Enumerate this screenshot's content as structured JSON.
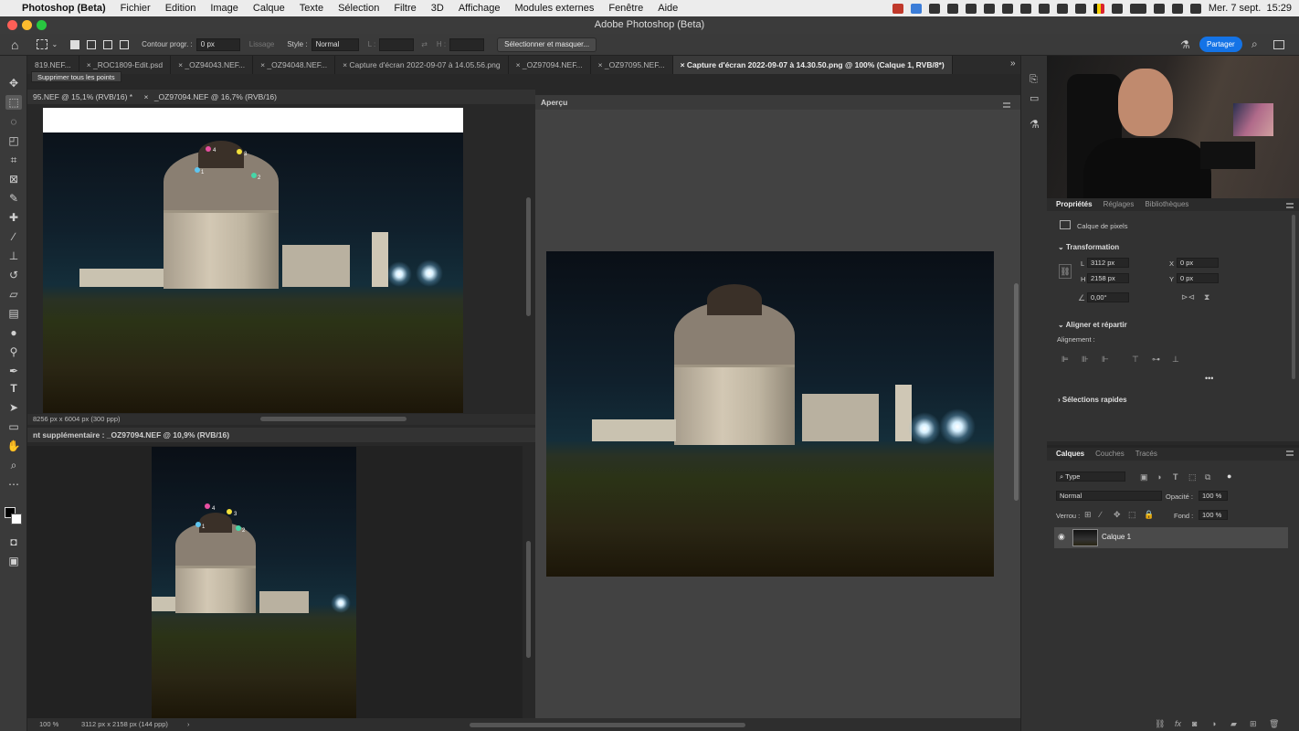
{
  "menubar": {
    "app": "Photoshop (Beta)",
    "items": [
      "Fichier",
      "Edition",
      "Image",
      "Calque",
      "Texte",
      "Sélection",
      "Filtre",
      "3D",
      "Affichage",
      "Modules externes",
      "Fenêtre",
      "Aide"
    ],
    "clock": "Mer. 7 sept.  15:29"
  },
  "window": {
    "title": "Adobe Photoshop (Beta)"
  },
  "options": {
    "contour_label": "Contour progr. :",
    "contour_value": "0 px",
    "lissage": "Lissage",
    "style_label": "Style :",
    "style_value": "Normal",
    "l_label": "L :",
    "h_label": "H :",
    "select_mask": "Sélectionner et masquer...",
    "share": "Partager"
  },
  "tabs": [
    {
      "label": "819.NEF..."
    },
    {
      "label": "_ROC1809-Edit.psd"
    },
    {
      "label": "_OZ94043.NEF..."
    },
    {
      "label": "_OZ94048.NEF..."
    },
    {
      "label": "Capture d'écran 2022-09-07 à 14.05.56.png"
    },
    {
      "label": "_OZ97094.NEF..."
    },
    {
      "label": "_OZ97095.NEF..."
    },
    {
      "label": "Capture d'écran 2022-09-07 à 14.30.50.png @ 100% (Calque 1, RVB/8*)"
    }
  ],
  "tooltip": "Supprimer tous les points",
  "pane1": {
    "tabs": [
      "95.NEF @ 15,1% (RVB/16) *",
      "_OZ97094.NEF @ 16,7% (RVB/16)"
    ],
    "status": "8256 px x 6004 px (300 ppp)"
  },
  "pane2": {
    "title": "nt supplémentaire : _OZ97094.NEF @ 10,9% (RVB/16)"
  },
  "preview": {
    "title": "Aperçu"
  },
  "status_bottom": {
    "zoom": "100 %",
    "size": "3112 px x 2158 px (144 ppp)"
  },
  "points": [
    "1",
    "2",
    "3",
    "4"
  ],
  "properties": {
    "tabs": [
      "Propriétés",
      "Réglages",
      "Bibliothèques"
    ],
    "layer_type": "Calque de pixels",
    "transform": "Transformation",
    "L_label": "L",
    "L": "3112 px",
    "H_label": "H",
    "H": "2158 px",
    "X_label": "X",
    "X": "0 px",
    "Y_label": "Y",
    "Y": "0 px",
    "angle": "0,00°",
    "align": "Aligner et répartir",
    "alignment": "Alignement :",
    "more": "•••",
    "quick": "Sélections rapides"
  },
  "layers": {
    "tabs": [
      "Calques",
      "Couches",
      "Tracés"
    ],
    "kind": "Type",
    "blend": "Normal",
    "opacity_label": "Opacité :",
    "opacity": "100 %",
    "lock_label": "Verrou :",
    "fill_label": "Fond :",
    "fill": "100 %",
    "layer_name": "Calque 1"
  },
  "colors": {
    "accent": "#1473e6",
    "panel": "#323232",
    "bg": "#282828"
  }
}
